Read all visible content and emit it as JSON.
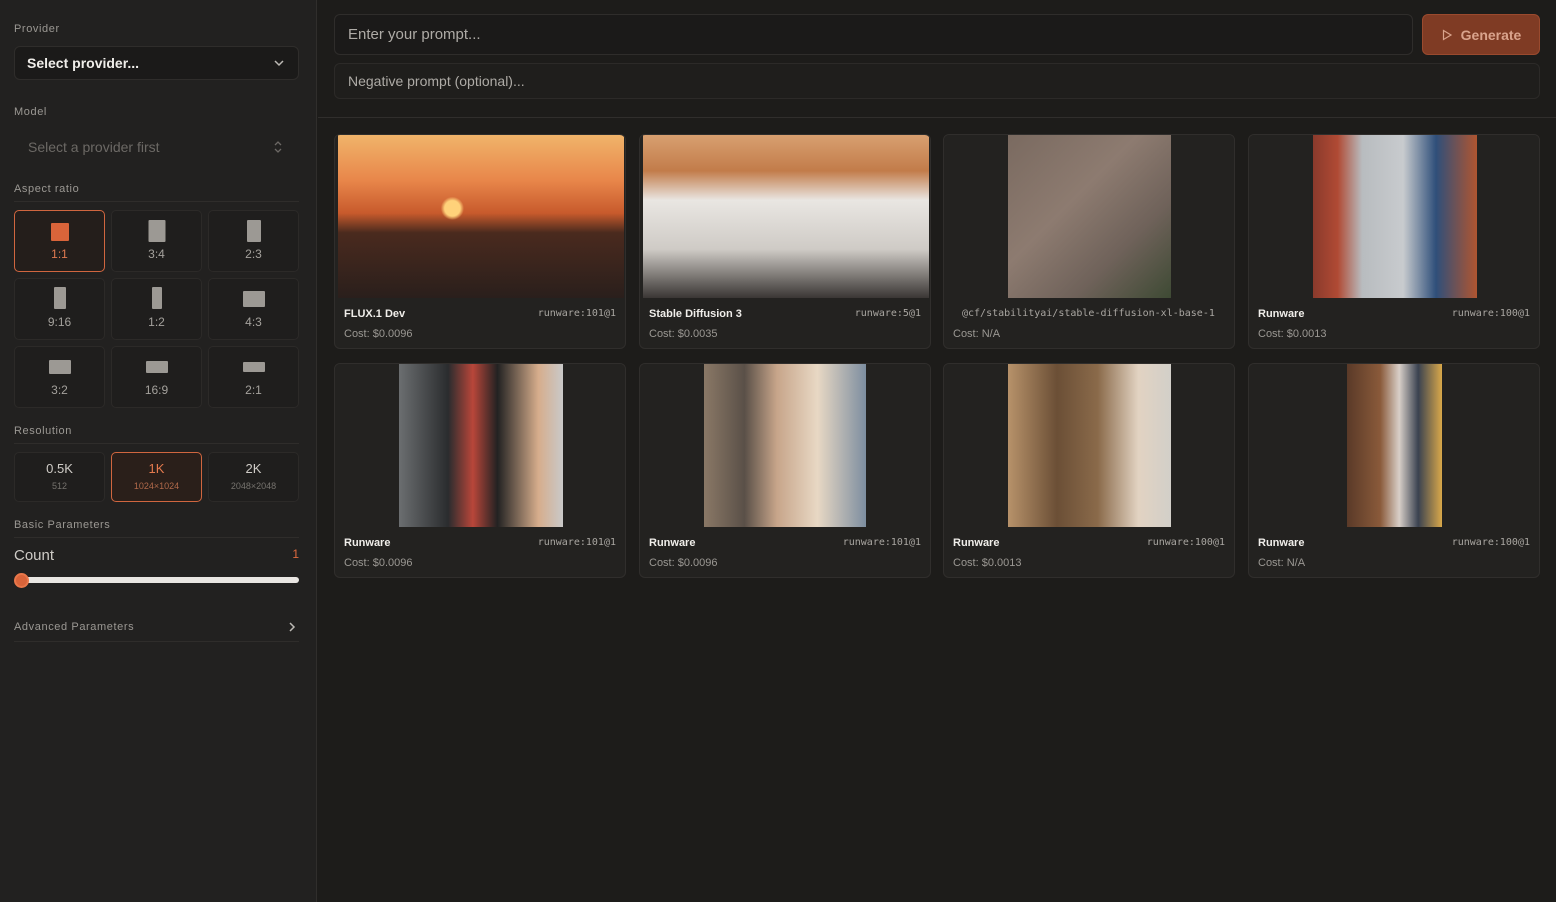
{
  "sidebar": {
    "provider_label": "Provider",
    "provider_value": "Select provider...",
    "model_label": "Model",
    "model_value": "Select a provider first",
    "aspect_label": "Aspect ratio",
    "aspect_ratios": [
      "1:1",
      "3:4",
      "2:3",
      "9:16",
      "1:2",
      "4:3",
      "3:2",
      "16:9",
      "2:1"
    ],
    "aspect_selected": "1:1",
    "resolution_label": "Resolution",
    "resolutions": [
      {
        "label": "0.5K",
        "sub": "512"
      },
      {
        "label": "1K",
        "sub": "1024×1024"
      },
      {
        "label": "2K",
        "sub": "2048×2048"
      }
    ],
    "resolution_selected": "1K",
    "basic_label": "Basic Parameters",
    "count_label": "Count",
    "count_value": "1",
    "advanced_label": "Advanced Parameters"
  },
  "prompt": {
    "placeholder": "Enter your prompt...",
    "negative_placeholder": "Negative prompt (optional)...",
    "generate_label": "Generate"
  },
  "gallery": [
    {
      "title": "FLUX.1 Dev",
      "model": "runware:101@1",
      "cost": "Cost: $0.0096"
    },
    {
      "title": "Stable Diffusion 3",
      "model": "runware:5@1",
      "cost": "Cost: $0.0035"
    },
    {
      "title": "",
      "model": "@cf/stabilityai/stable-diffusion-xl-base-1",
      "cost": "Cost: N/A"
    },
    {
      "title": "Runware",
      "model": "runware:100@1",
      "cost": "Cost: $0.0013"
    },
    {
      "title": "Runware",
      "model": "runware:101@1",
      "cost": "Cost: $0.0096"
    },
    {
      "title": "Runware",
      "model": "runware:101@1",
      "cost": "Cost: $0.0096"
    },
    {
      "title": "Runware",
      "model": "runware:100@1",
      "cost": "Cost: $0.0013"
    },
    {
      "title": "Runware",
      "model": "runware:100@1",
      "cost": "Cost: N/A"
    }
  ],
  "colors": {
    "accent": "#d9643a",
    "background": "#1d1c1a",
    "sidebar": "#222120"
  }
}
